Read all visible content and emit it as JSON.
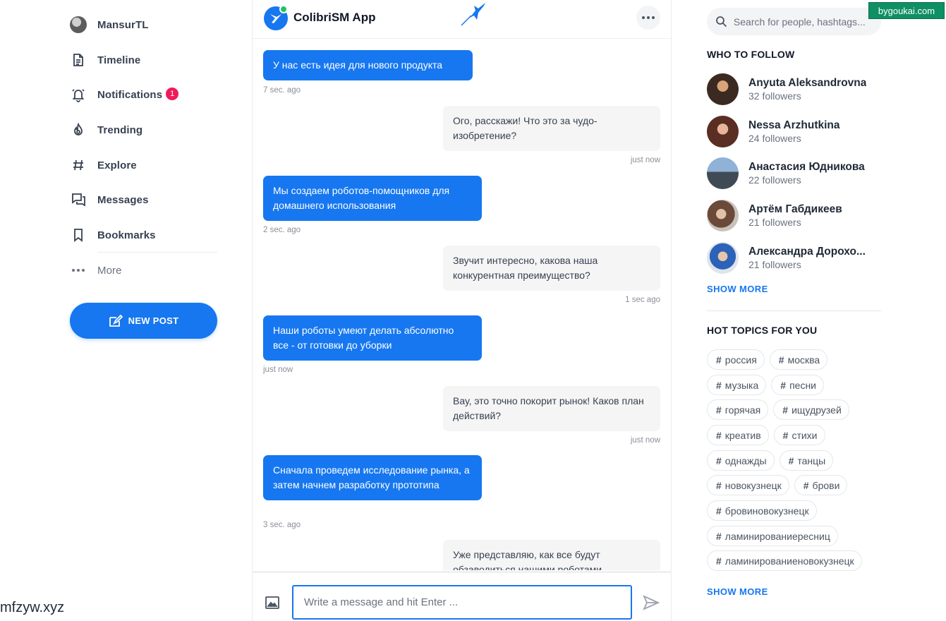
{
  "sidebar": {
    "profile": {
      "label": "MansurTL"
    },
    "items": [
      {
        "label": "Timeline",
        "icon": "timeline-icon"
      },
      {
        "label": "Notifications",
        "icon": "bell-icon",
        "badge": "1"
      },
      {
        "label": "Trending",
        "icon": "fire-icon"
      },
      {
        "label": "Explore",
        "icon": "hash-icon"
      },
      {
        "label": "Messages",
        "icon": "messages-icon"
      },
      {
        "label": "Bookmarks",
        "icon": "bookmark-icon"
      }
    ],
    "more_label": "More",
    "new_post_label": "NEW POST"
  },
  "chat": {
    "title": "ColibriSM App",
    "messages": [
      {
        "side": "out",
        "text": "У нас есть идея для нового продукта",
        "time": "7 sec. ago"
      },
      {
        "side": "in",
        "text": "Ого, расскажи! Что это за чудо-изобретение?",
        "time": "just now"
      },
      {
        "side": "out",
        "text": "Мы создаем роботов-помощников для домашнего использования",
        "time": "2 sec. ago"
      },
      {
        "side": "in",
        "text": "Звучит интересно, какова наша конкурентная преимущество?",
        "time": "1 sec ago"
      },
      {
        "side": "out",
        "text": "Наши роботы умеют делать абсолютно все - от готовки до уборки",
        "time": "just now"
      },
      {
        "side": "in",
        "text": "Вау, это точно покорит рынок! Каков план действий?",
        "time": "just now"
      },
      {
        "side": "out",
        "text": "Сначала проведем исследование рынка, а затем начнем разработку прототипа",
        "time": "3 sec. ago"
      },
      {
        "side": "in",
        "text": "Уже представляю, как все будут обзаводиться нашими роботами",
        "time": ""
      }
    ],
    "input_placeholder": "Write a message and hit Enter ..."
  },
  "right": {
    "search_placeholder": "Search for people, hashtags...",
    "who_to_follow_title": "WHO TO FOLLOW",
    "follow": [
      {
        "name": "Anyuta Aleksandrovna",
        "followers": "32 followers"
      },
      {
        "name": "Nessa Arzhutkina",
        "followers": "24 followers"
      },
      {
        "name": "Анастасия Юдникова",
        "followers": "22 followers"
      },
      {
        "name": "Артём Габдикеев",
        "followers": "21 followers"
      },
      {
        "name": "Александра Дорохо...",
        "followers": "21 followers"
      }
    ],
    "show_more_label": "SHOW MORE",
    "hot_topics_title": "HOT TOPICS FOR YOU",
    "tags": [
      [
        "россия",
        "москва"
      ],
      [
        "музыка",
        "песни"
      ],
      [
        "горячая",
        "ищудрузей"
      ],
      [
        "креатив",
        "стихи"
      ],
      [
        "однажды",
        "танцы"
      ],
      [
        "новокузнецк",
        "брови"
      ],
      [
        "бровиновокузнецк"
      ],
      [
        "ламинированиересниц"
      ],
      [
        "ламинированиеновокузнецк"
      ]
    ],
    "show_more_label_2": "SHOW MORE"
  },
  "watermarks": {
    "top": "bygoukai.com",
    "bottom": "mfzyw.xyz"
  },
  "colors": {
    "accent": "#1677f0",
    "badge": "#f0195c",
    "online": "#22c55e"
  }
}
